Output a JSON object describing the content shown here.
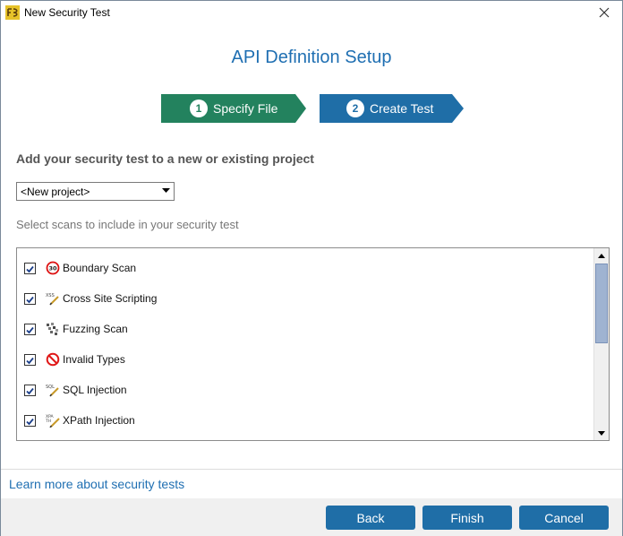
{
  "window": {
    "title": "New Security Test",
    "app_icon": "app-logo-icon",
    "close_icon": "close-icon"
  },
  "header": {
    "title": "API Definition Setup"
  },
  "steps": [
    {
      "number": "1",
      "label": "Specify File",
      "color": "#23825e"
    },
    {
      "number": "2",
      "label": "Create Test",
      "color": "#1f6ea7"
    }
  ],
  "project": {
    "heading": "Add your security test to a new or existing project",
    "selected": "<New project>"
  },
  "scans": {
    "instructions": "Select scans to include in your security test",
    "items": [
      {
        "label": "Boundary Scan",
        "checked": true,
        "icon": "boundary-icon"
      },
      {
        "label": "Cross Site Scripting",
        "checked": true,
        "icon": "xss-icon"
      },
      {
        "label": "Fuzzing Scan",
        "checked": true,
        "icon": "fuzzing-icon"
      },
      {
        "label": "Invalid Types",
        "checked": true,
        "icon": "invalid-icon"
      },
      {
        "label": "SQL Injection",
        "checked": true,
        "icon": "sql-icon"
      },
      {
        "label": "XPath Injection",
        "checked": true,
        "icon": "xpath-icon"
      }
    ]
  },
  "links": {
    "learn_more": "Learn more about security tests"
  },
  "buttons": {
    "back": "Back",
    "finish": "Finish",
    "cancel": "Cancel"
  },
  "colors": {
    "accent": "#1f6ea7",
    "step_done": "#23825e",
    "title_blue": "#1f6fb2"
  }
}
